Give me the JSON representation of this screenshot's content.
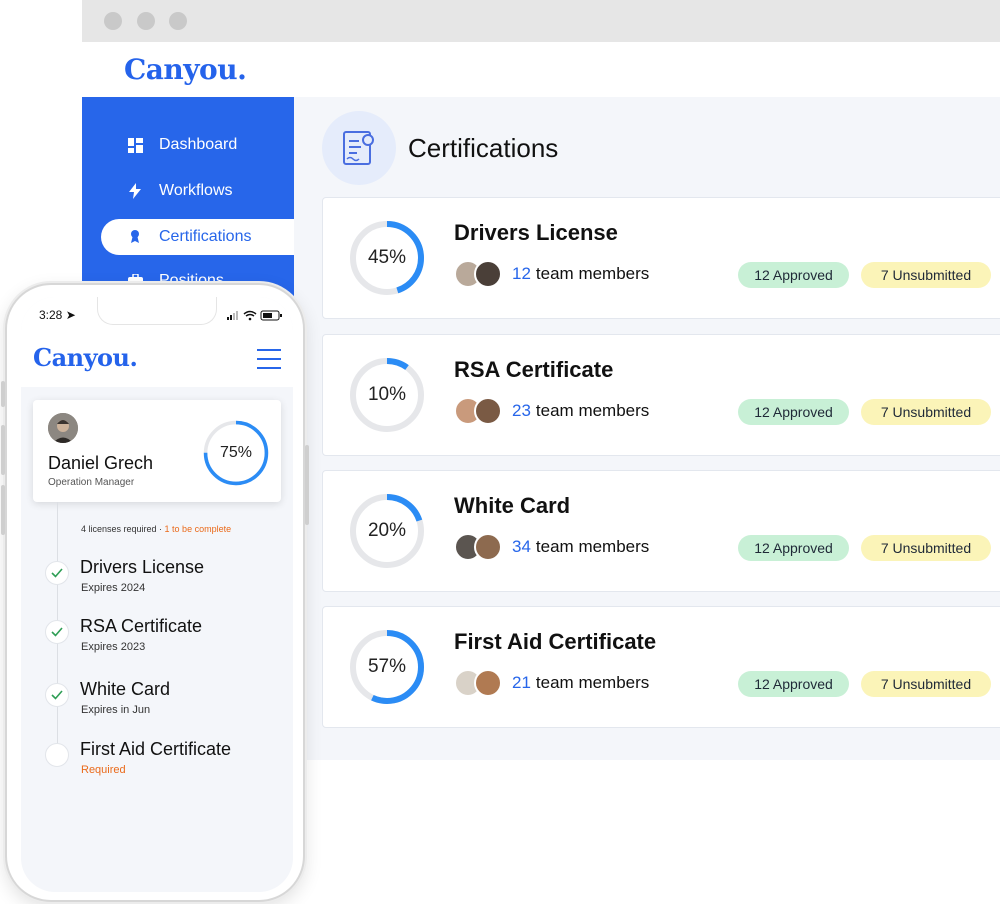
{
  "desktop": {
    "brand": "Canyou.",
    "sidebar": {
      "items": [
        {
          "label": "Dashboard",
          "icon": "dashboard-icon",
          "active": false
        },
        {
          "label": "Workflows",
          "icon": "bolt-icon",
          "active": false
        },
        {
          "label": "Certifications",
          "icon": "award-icon",
          "active": true
        },
        {
          "label": "Positions",
          "icon": "briefcase-icon",
          "active": false
        }
      ]
    },
    "page_title": "Certifications",
    "certifications": [
      {
        "name": "Drivers License",
        "progress": 45,
        "progress_label": "45%",
        "member_count": "12",
        "members_text": "team members",
        "approved": "12 Approved",
        "unsubmitted": "7 Unsubmitted"
      },
      {
        "name": "RSA Certificate",
        "progress": 10,
        "progress_label": "10%",
        "member_count": "23",
        "members_text": "team members",
        "approved": "12 Approved",
        "unsubmitted": "7 Unsubmitted"
      },
      {
        "name": "White Card",
        "progress": 20,
        "progress_label": "20%",
        "member_count": "34",
        "members_text": "team members",
        "approved": "12 Approved",
        "unsubmitted": "7 Unsubmitted"
      },
      {
        "name": "First Aid Certificate",
        "progress": 57,
        "progress_label": "57%",
        "member_count": "21",
        "members_text": "team members",
        "approved": "12 Approved",
        "unsubmitted": "7 Unsubmitted"
      }
    ]
  },
  "mobile": {
    "time": "3:28",
    "brand": "Canyou.",
    "profile": {
      "name": "Daniel Grech",
      "role": "Operation Manager",
      "progress": 75,
      "progress_label": "75%"
    },
    "requirements": {
      "text": "4 licenses required",
      "separator": " · ",
      "pending": "1 to be complete"
    },
    "licenses": [
      {
        "name": "Drivers License",
        "status": "Expires 2024",
        "done": true
      },
      {
        "name": "RSA Certificate",
        "status": "Expires 2023",
        "done": true
      },
      {
        "name": "White Card",
        "status": "Expires in Jun",
        "done": true
      },
      {
        "name": "First Aid Certificate",
        "status": "Required",
        "done": false
      }
    ]
  },
  "colors": {
    "brand_blue": "#2766ea",
    "approved_bg": "#c8f0d6",
    "unsubmitted_bg": "#fbf4b8",
    "ring_track": "#e6e7ea",
    "ring_fill": "#2b8cf5",
    "warning_orange": "#ea6a1a"
  }
}
